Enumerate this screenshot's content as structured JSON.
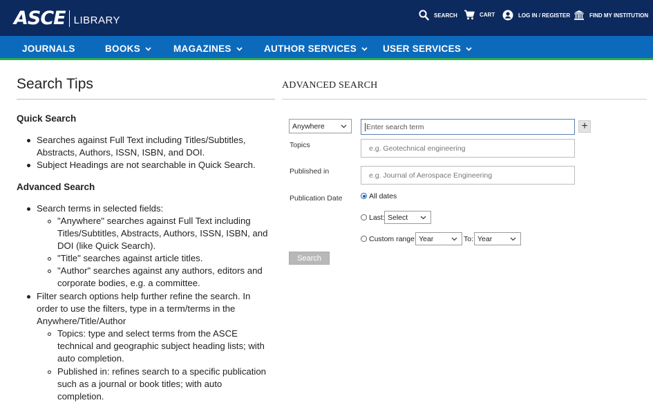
{
  "header": {
    "logo_main": "ASCE",
    "logo_sub": "LIBRARY",
    "utilities": [
      {
        "label": "SEARCH",
        "icon": "search-icon"
      },
      {
        "label": "CART",
        "icon": "cart-icon"
      },
      {
        "label": "LOG IN / REGISTER",
        "icon": "user-icon"
      },
      {
        "label": "FIND MY INSTITUTION",
        "icon": "institution-icon"
      }
    ]
  },
  "nav": {
    "items": [
      {
        "label": "JOURNALS",
        "dropdown": false
      },
      {
        "label": "BOOKS",
        "dropdown": true
      },
      {
        "label": "MAGAZINES",
        "dropdown": true
      },
      {
        "label": "AUTHOR SERVICES",
        "dropdown": true
      },
      {
        "label": "USER SERVICES",
        "dropdown": true
      }
    ]
  },
  "tips": {
    "title": "Search Tips",
    "quick_heading": "Quick Search",
    "quick_lines": [
      "Searches against Full Text including Titles/Subtitles,",
      "Abstracts, Authors, ISSN, ISBN, and DOI.",
      "Subject Headings are not searchable in Quick Search."
    ],
    "adv_heading": "Advanced Search",
    "adv_lines": [
      "Search terms in selected fields:",
      "\"Anywhere\" searches against Full Text including",
      "Titles/Subtitles, Abstracts, Authors, ISSN, ISBN, and",
      "DOI (like Quick Search).",
      "\"Title\" searches against article titles.",
      "\"Author\" searches against any authors, editors and",
      "corporate bodies, e.g. a committee.",
      "Filter search options help further refine the search. In",
      "order to use the filters, type in a term/terms in the",
      "Anywhere/Title/Author",
      "Topics: type and select terms from the ASCE",
      "technical and geographic subject heading lists; with",
      "auto completion.",
      "Published in: refines search to a specific publication",
      "such as a journal or book titles; with auto",
      "completion."
    ]
  },
  "advanced": {
    "title": "ADVANCED SEARCH",
    "field_select": "Anywhere",
    "search_placeholder": "Enter search term",
    "plus_label": "+",
    "topics_label": "Topics",
    "topics_placeholder": "e.g. Geotechnical engineering",
    "published_label": "Published in",
    "published_placeholder": "e.g. Journal of Aerospace Engineering",
    "date_label": "Publication Date",
    "opt_all": "All dates",
    "opt_last": "Last:",
    "last_select": "Select",
    "opt_custom": "Custom range:",
    "from_select": "Year",
    "to_label": "To:",
    "to_select": "Year",
    "search_button": "Search"
  }
}
